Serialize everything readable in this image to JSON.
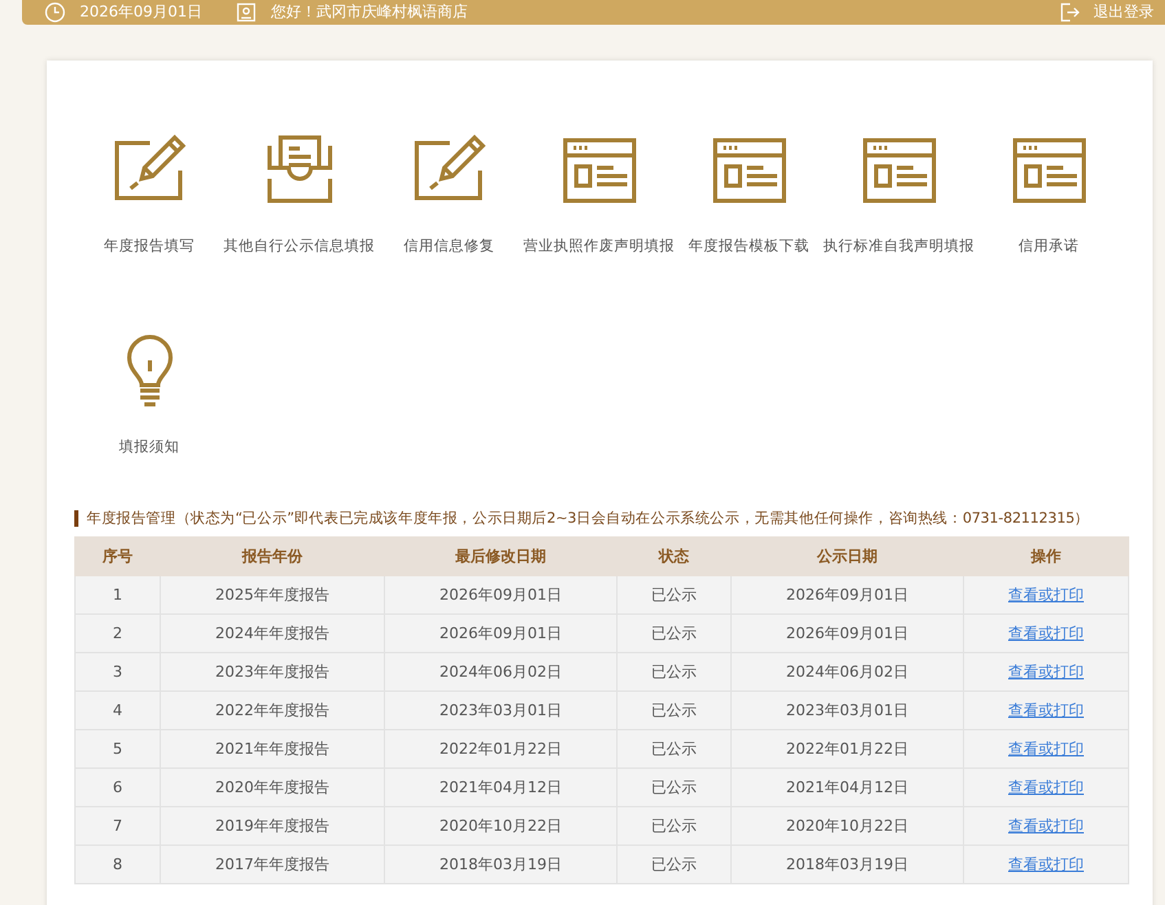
{
  "header": {
    "date": "2026年09月01日",
    "greeting": "您好！武冈市庆峰村枫语商店",
    "logout": "退出登录"
  },
  "tiles": [
    {
      "kind": "pen",
      "label": "年度报告填写"
    },
    {
      "kind": "inbox",
      "label": "其他自行公示信息填报"
    },
    {
      "kind": "pen",
      "label": "信用信息修复"
    },
    {
      "kind": "window",
      "label": "营业执照作废声明填报"
    },
    {
      "kind": "window",
      "label": "年度报告模板下载"
    },
    {
      "kind": "window",
      "label": "执行标准自我声明填报"
    },
    {
      "kind": "window",
      "label": "信用承诺"
    },
    {
      "kind": "bulb",
      "label": "填报须知"
    }
  ],
  "section": {
    "title": "年度报告管理（状态为“已公示”即代表已完成该年度年报，公示日期后2~3日会自动在公示系统公示，无需其他任何操作，咨询热线：0731-82112315）"
  },
  "table": {
    "columns": [
      "序号",
      "报告年份",
      "最后修改日期",
      "状态",
      "公示日期",
      "操作"
    ],
    "rows": [
      [
        "1",
        "2025年年度报告",
        "2026年09月01日",
        "已公示",
        "2026年09月01日",
        "查看或打印"
      ],
      [
        "2",
        "2024年年度报告",
        "2026年09月01日",
        "已公示",
        "2026年09月01日",
        "查看或打印"
      ],
      [
        "3",
        "2023年年度报告",
        "2024年06月02日",
        "已公示",
        "2024年06月02日",
        "查看或打印"
      ],
      [
        "4",
        "2022年年度报告",
        "2023年03月01日",
        "已公示",
        "2023年03月01日",
        "查看或打印"
      ],
      [
        "5",
        "2021年年度报告",
        "2022年01月22日",
        "已公示",
        "2022年01月22日",
        "查看或打印"
      ],
      [
        "6",
        "2020年年度报告",
        "2021年04月12日",
        "已公示",
        "2021年04月12日",
        "查看或打印"
      ],
      [
        "7",
        "2019年年度报告",
        "2020年10月22日",
        "已公示",
        "2020年10月22日",
        "查看或打印"
      ],
      [
        "8",
        "2017年年度报告",
        "2018年03月19日",
        "已公示",
        "2018年03月19日",
        "查看或打印"
      ]
    ]
  }
}
